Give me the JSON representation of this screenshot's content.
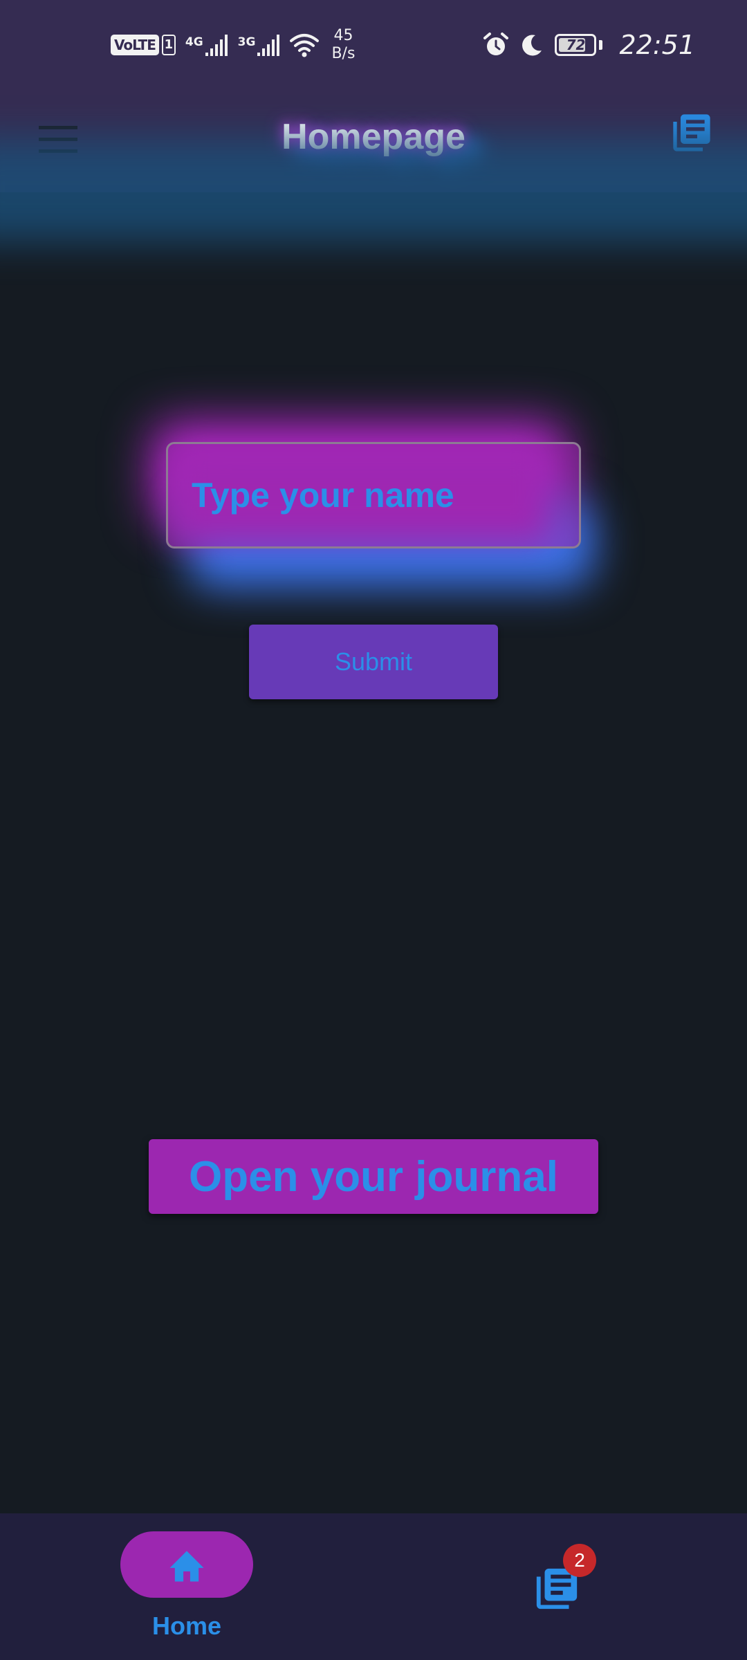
{
  "status_bar": {
    "volte": "VoLTE",
    "sim": "1",
    "network_1": "4G",
    "network_2": "3G",
    "speed_value": "45",
    "speed_unit": "B/s",
    "battery": "72",
    "time": "22:51"
  },
  "app_bar": {
    "title": "Homepage",
    "menu_icon": "hamburger-menu-icon",
    "journal_icon": "library-books-icon"
  },
  "form": {
    "name_placeholder": "Type your name",
    "name_value": "",
    "submit_label": "Submit"
  },
  "journal_button_label": "Open your journal",
  "bottom_nav": {
    "items": [
      {
        "label": "Home",
        "icon": "home-icon",
        "selected": true
      },
      {
        "label": "",
        "icon": "library-books-icon",
        "badge": "2"
      }
    ]
  },
  "colors": {
    "app_bar": "#352c52",
    "background": "#151b22",
    "accent_pink": "#9c27b0",
    "accent_purple": "#673ab7",
    "text_blue": "#2b8fe8",
    "badge_red": "#c6282a",
    "bottom_nav": "#211f3d"
  }
}
